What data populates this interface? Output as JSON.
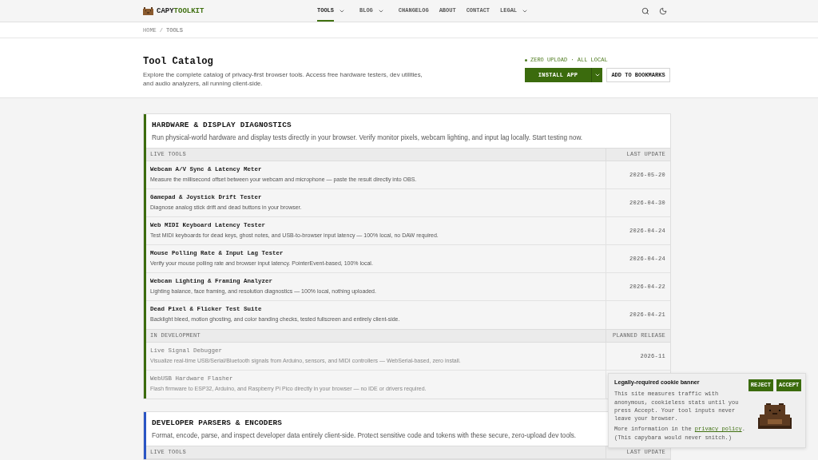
{
  "header": {
    "logo": {
      "primary": "CAPY",
      "accent": "TOOLKIT"
    },
    "nav": [
      {
        "label": "TOOLS",
        "selected": true,
        "dropdown": true
      },
      {
        "label": "BLOG",
        "selected": false,
        "dropdown": true
      },
      {
        "label": "CHANGELOG",
        "selected": false,
        "dropdown": false
      },
      {
        "label": "ABOUT",
        "selected": false,
        "dropdown": false
      },
      {
        "label": "CONTACT",
        "selected": false,
        "dropdown": false
      },
      {
        "label": "LEGAL",
        "selected": false,
        "dropdown": true
      }
    ]
  },
  "breadcrumb": {
    "items": [
      "HOME",
      "TOOLS"
    ],
    "separator": "/"
  },
  "hero": {
    "title": "Tool Catalog",
    "description": "Explore the complete catalog of privacy-first browser tools. Access free hardware testers, dev utilities, and audio analyzers, all running client-side.",
    "badge": "ZERO UPLOAD · ALL LOCAL",
    "buttons": [
      {
        "label": "INSTALL APP",
        "kind": "split"
      },
      {
        "label": "ADD TO BOOKMARKS",
        "kind": "outline"
      }
    ]
  },
  "sections": [
    {
      "title": "HARDWARE & DISPLAY DIAGNOSTICS",
      "description": "Run physical-world hardware and display tests directly in your browser. Verify monitor pixels, webcam lighting, and input lag locally. Start testing now.",
      "color": "#3b6b0d",
      "groups": [
        {
          "kind": "live",
          "heading": "LIVE TOOLS",
          "date_heading": "LAST UPDATE",
          "rows": [
            {
              "name": "Webcam A/V Sync & Latency Meter",
              "description": "Measure the millisecond offset between your webcam and microphone — paste the result directly into OBS.",
              "date": "2026-05-20"
            },
            {
              "name": "Gamepad & Joystick Drift Tester",
              "description": "Diagnose analog stick drift and dead buttons in your browser.",
              "date": "2026-04-30"
            },
            {
              "name": "Web MIDI Keyboard Latency Tester",
              "description": "Test MIDI keyboards for dead keys, ghost notes, and USB-to-browser input latency — 100% local, no DAW required.",
              "date": "2026-04-24"
            },
            {
              "name": "Mouse Polling Rate & Input Lag Tester",
              "description": "Verify your mouse polling rate and browser input latency. PointerEvent-based, 100% local.",
              "date": "2026-04-24"
            },
            {
              "name": "Webcam Lighting & Framing Analyzer",
              "description": "Lighting balance, face framing, and resolution diagnostics — 100% local, nothing uploaded.",
              "date": "2026-04-22"
            },
            {
              "name": "Dead Pixel & Flicker Test Suite",
              "description": "Backlight bleed, motion ghosting, and color banding checks, tested fullscreen and entirely client-side.",
              "date": "2026-04-21"
            }
          ]
        },
        {
          "kind": "development",
          "heading": "IN DEVELOPMENT",
          "date_heading": "PLANNED RELEASE",
          "rows": [
            {
              "name": "Live Signal Debugger",
              "description": "Visualize real-time USB/Serial/Bluetooth signals from Arduino, sensors, and MIDI controllers — WebSerial-based, zero install.",
              "date": "2026-11"
            },
            {
              "name": "WebUSB Hardware Flasher",
              "description": "Flash firmware to ESP32, Arduino, and Raspberry Pi Pico directly in your browser — no IDE or drivers required."
            }
          ]
        }
      ]
    },
    {
      "title": "DEVELOPER PARSERS & ENCODERS",
      "description": "Format, encode, parse, and inspect developer data entirely client-side. Protect sensitive code and tokens with these secure, zero-upload dev tools.",
      "color": "#2a55c4",
      "groups": [
        {
          "kind": "live",
          "heading": "LIVE TOOLS",
          "date_heading": "LAST UPDATE"
        }
      ]
    }
  ],
  "cookie_banner": {
    "title": "Legally-required cookie banner",
    "text": "This site measures traffic with anonymous, cookieless stats until you press Accept. Your tool inputs never leave your browser.",
    "more_info": {
      "before": "More information in the ",
      "link": "privacy policy",
      "after": ".",
      "note": "(This capybara would never snitch.)"
    },
    "buttons": [
      "REJECT",
      "ACCEPT"
    ]
  }
}
